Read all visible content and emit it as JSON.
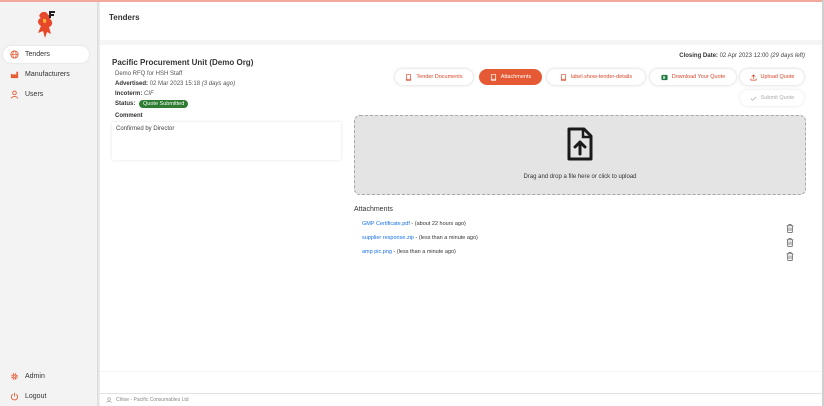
{
  "sidebar": {
    "items": [
      {
        "label": "Tenders",
        "icon": "globe-icon"
      },
      {
        "label": "Manufacturers",
        "icon": "factory-icon"
      },
      {
        "label": "Users",
        "icon": "user-icon"
      }
    ],
    "bottom": [
      {
        "label": "Admin",
        "icon": "gear-icon"
      },
      {
        "label": "Logout",
        "icon": "power-icon"
      }
    ]
  },
  "header": {
    "title": "Tenders"
  },
  "tender": {
    "org": "Pacific Procurement Unit (Demo Org)",
    "subtitle": "Demo RFQ for HSH Staff",
    "advertised_label": "Advertised:",
    "advertised_date": "02 Mar 2023 15:18",
    "advertised_ago": "(3 days ago)",
    "incoterm_label": "Incoterm:",
    "incoterm_value": "CIF",
    "status_label": "Status:",
    "status_value": "Quote Submitted",
    "comment_label": "Comment",
    "comment_value": "Confirmed by Director",
    "closing_label": "Closing Date:",
    "closing_date": "02 Apr 2023 12:00",
    "closing_left": "(29 days left)"
  },
  "buttons": {
    "tender_documents": "Tender Documents",
    "attachments": "Attachments",
    "show_details": "label.show-tender-details",
    "download_quote": "Download Your Quote",
    "upload_quote": "Upload Quote",
    "submit_quote": "Submit Quote"
  },
  "dropzone": {
    "text": "Drag and drop a file here or click to upload"
  },
  "attachments": {
    "title": "Attachments",
    "items": [
      {
        "name": "GMP Certificate.pdf",
        "when": " - (about 22 hours ago)"
      },
      {
        "name": "supplier response.zip",
        "when": " - (less than a minute ago)"
      },
      {
        "name": "amp pic.png",
        "when": " - (less than a minute ago)"
      }
    ]
  },
  "footer": {
    "user": "Chloe - Pacific Consumables Ltd"
  },
  "colors": {
    "accent": "#e55a35",
    "status_green": "#2e7d32",
    "link": "#1a73e8"
  }
}
